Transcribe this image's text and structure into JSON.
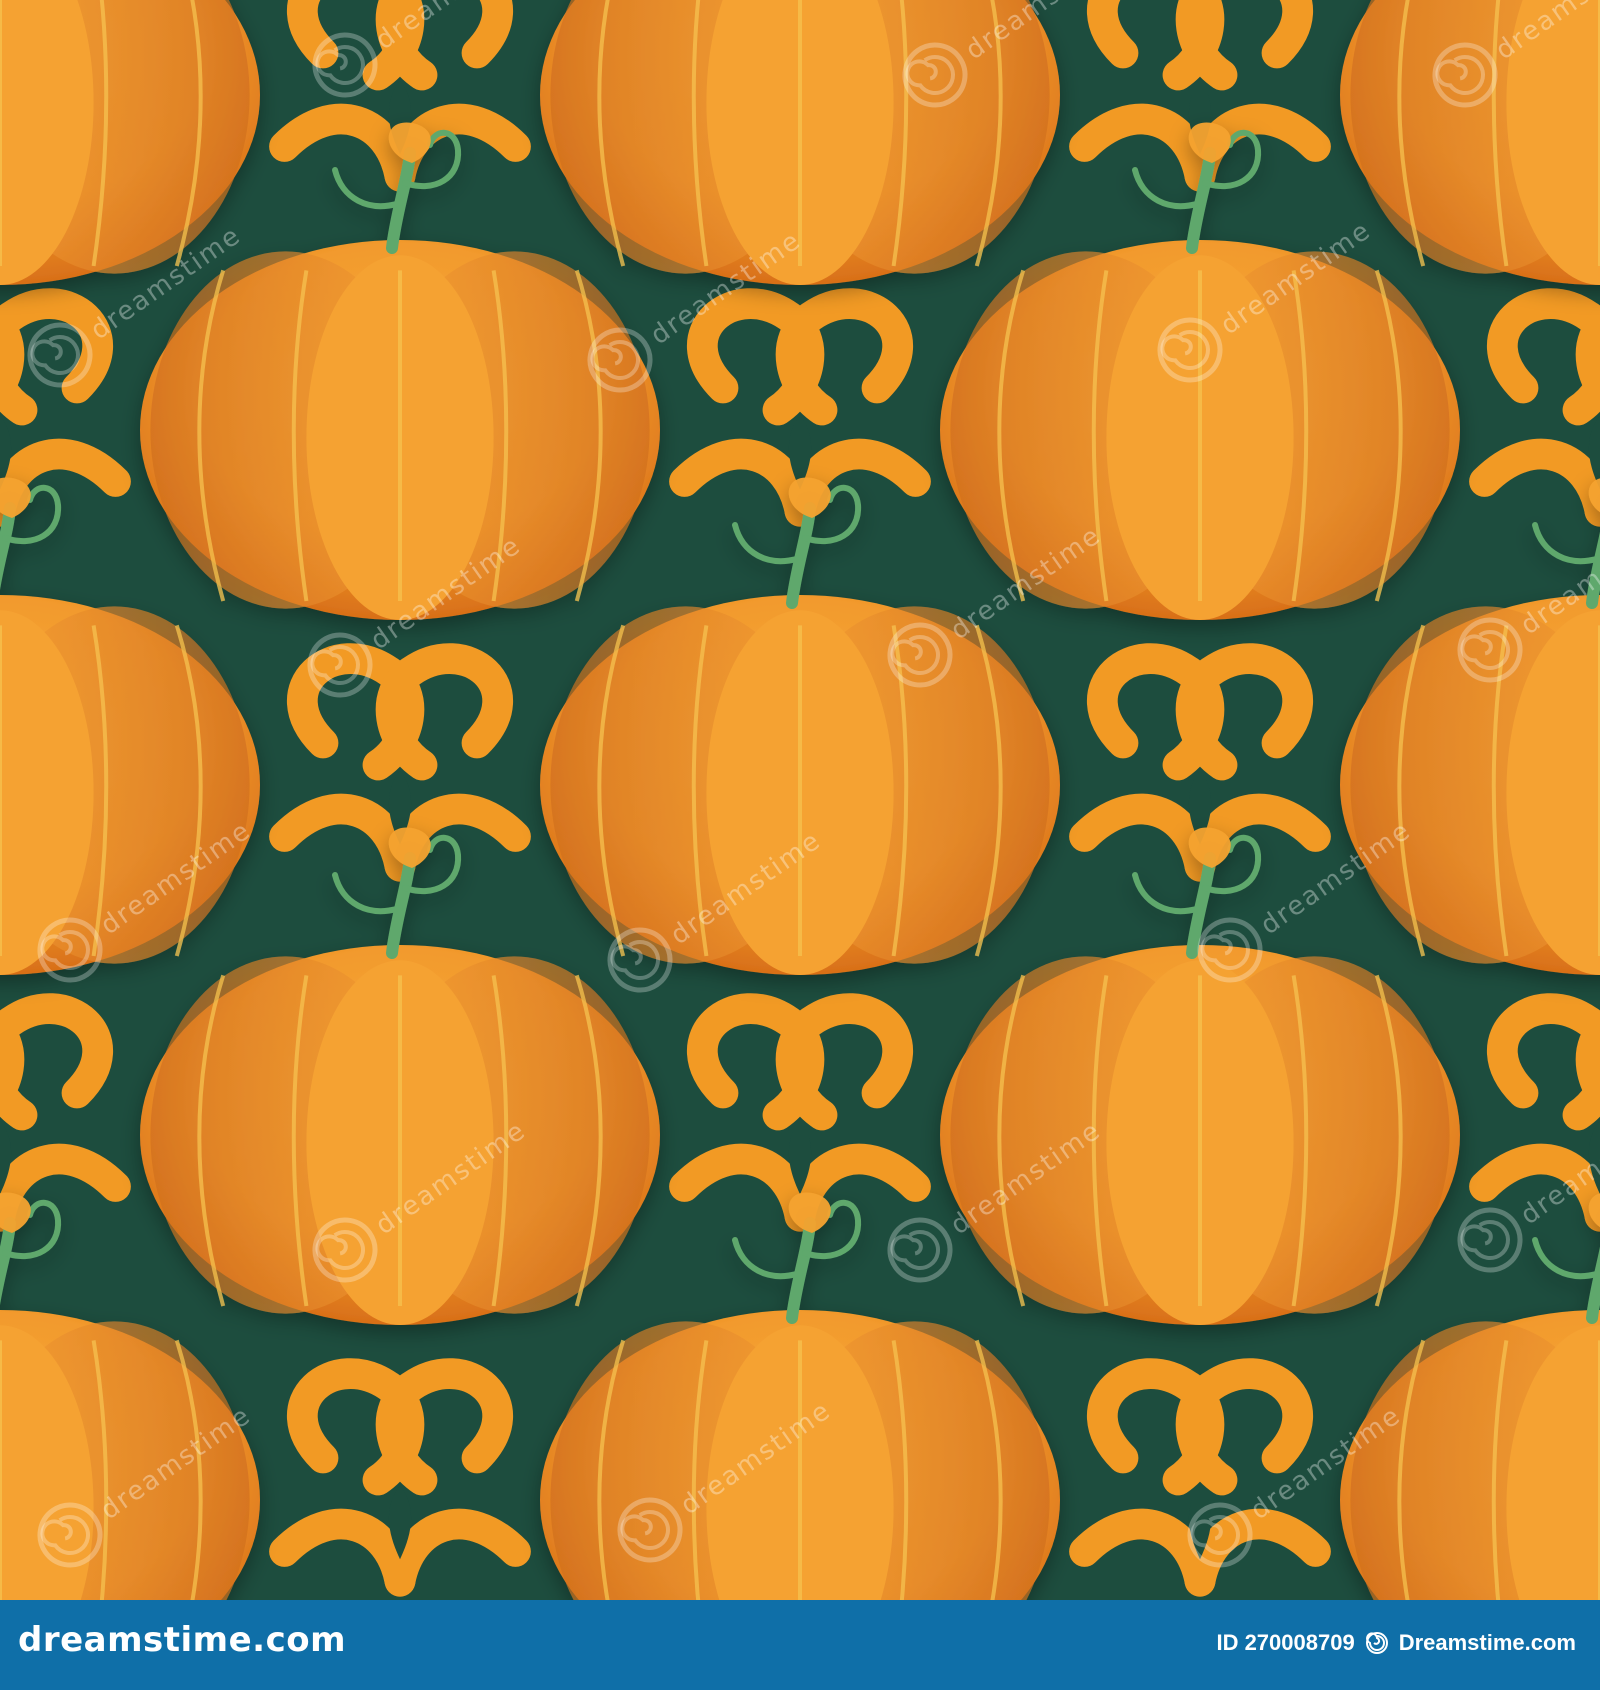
{
  "image": {
    "subject": "seamless pumpkin pattern",
    "colors": {
      "background_green": "#1d4d3e",
      "pumpkin_orange": "#f3a02f",
      "pumpkin_dark": "#d76d18",
      "scroll_orange": "#f29a24",
      "stem_green": "#5ea86c"
    }
  },
  "watermark": {
    "text": "dreamstime",
    "icon": "spiral-watermark-icon"
  },
  "footer": {
    "domain": "dreamstime.com",
    "id_label": "ID 270008709",
    "brand": "Dreamstime.com",
    "brand_icon": "dreamstime-logo-icon",
    "background": "#0f6fa8"
  }
}
